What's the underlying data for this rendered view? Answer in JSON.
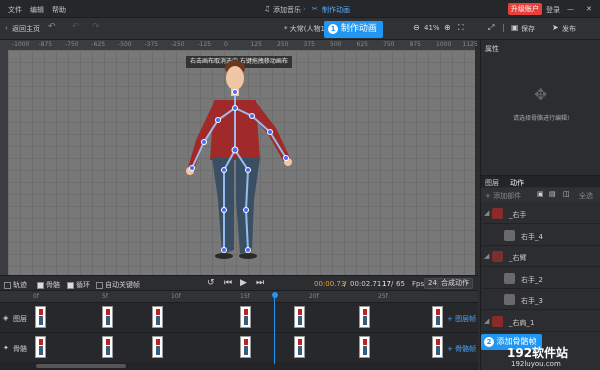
{
  "menu": {
    "file": "文件",
    "edit": "编辑",
    "help": "帮助",
    "add_music": "添加音乐",
    "make_animation": "制作动画",
    "upgrade": "升级账户",
    "login": "登录"
  },
  "toolbar": {
    "back": "返回主页",
    "doc_title": "* 大常(人物1)*",
    "zoom": "41%",
    "save": "保存",
    "publish": "发布"
  },
  "ruler": {
    "ticks": [
      "-1000",
      "-875",
      "-750",
      "-625",
      "-500",
      "-375",
      "-250",
      "-125",
      "0",
      "125",
      "250",
      "375",
      "500",
      "625",
      "750",
      "875",
      "1000",
      "1125"
    ]
  },
  "callout1": {
    "num": "1",
    "text": "制作动画"
  },
  "callout2": {
    "num": "2",
    "text": "添加骨骼帧"
  },
  "canvas": {
    "hint": "右击画布取消选中,右键拖拽移动画布"
  },
  "properties": {
    "title": "属性",
    "hint": "请选择骨骼进行编辑!"
  },
  "tabs": {
    "layers": "图层",
    "animation": "动作"
  },
  "rp_actions": {
    "add_part": "+ 添加部件",
    "all_select": "全选"
  },
  "rp_items": [
    {
      "label": "_右手",
      "level": 0,
      "color": "#8b2a2a"
    },
    {
      "label": "右手_4",
      "level": 1,
      "color": "#6a6a6a"
    },
    {
      "label": "_右臂",
      "level": 0,
      "color": "#7a3030"
    },
    {
      "label": "右手_2",
      "level": 1,
      "color": "#6a6a6a"
    },
    {
      "label": "右手_3",
      "level": 1,
      "color": "#6a6a6a"
    },
    {
      "label": "_右肩_1",
      "level": 0,
      "color": "#8b2a2a"
    }
  ],
  "timeline": {
    "show_track": "轨迹",
    "show_bone": "骨骼",
    "loop": "循环",
    "auto_keyframe": "自动关键帧",
    "time_current": "00:00.73",
    "time_sep": "/",
    "time_total": "00:02.71",
    "frame_current": "17",
    "frame_total": "65",
    "fps_label": "Fps",
    "fps_value": "24",
    "compose": "合成动作",
    "ruler_ticks": [
      "0f",
      "5f",
      "10f",
      "15f",
      "20f",
      "25f"
    ],
    "track_layer": "图层",
    "track_bone": "骨骼",
    "add_layer_frame": "+ 图层帧",
    "add_bone_frame": "+ 骨骼帧"
  },
  "watermark": {
    "brand": "192软件站",
    "url": "192luyou.com"
  }
}
